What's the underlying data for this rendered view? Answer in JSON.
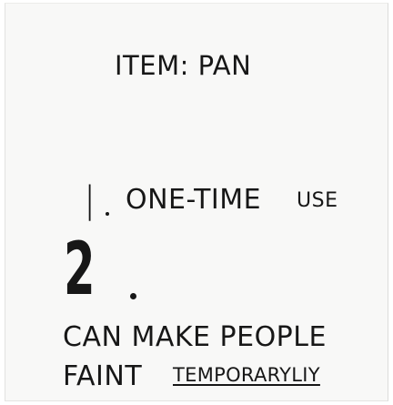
{
  "note": {
    "title": "ITEM: PAN",
    "point1": {
      "number": "|",
      "text": "ONE-TIME",
      "suffix": "USE"
    },
    "point2": {
      "number": "2",
      "line1": "CAN MAKE PEOPLE",
      "line2": "FAINT",
      "line2_suffix": "TEMPORARYLIY"
    }
  }
}
